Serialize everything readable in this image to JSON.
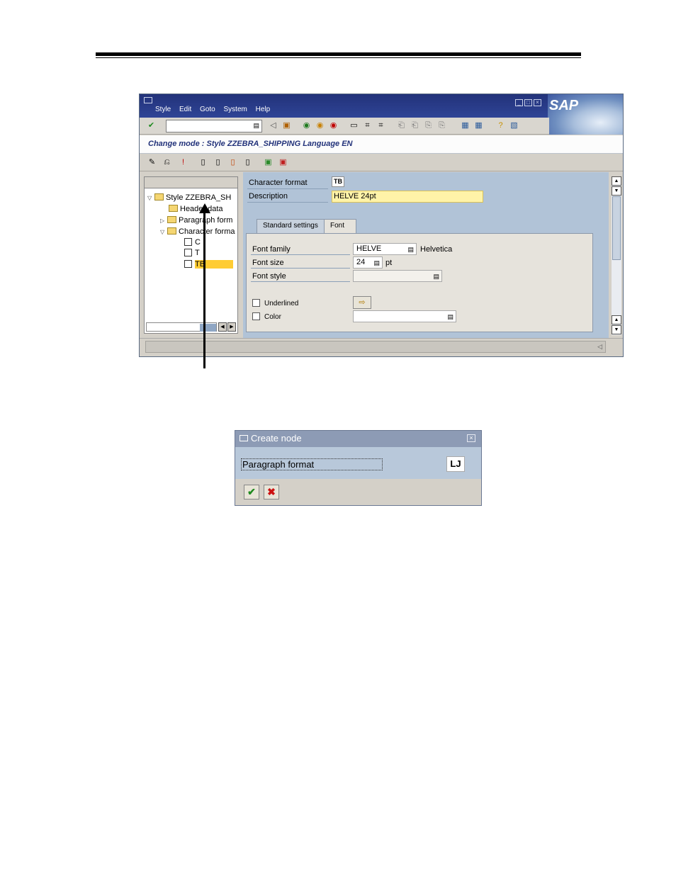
{
  "window": {
    "menu": [
      "Style",
      "Edit",
      "Goto",
      "System",
      "Help"
    ],
    "brand": "SAP",
    "mode_title": "Change mode : Style ZZEBRA_SHIPPING Language EN"
  },
  "tree": {
    "root": "Style ZZEBRA_SH",
    "header": "Header data",
    "paragraph": "Paragraph form",
    "character": "Character forma",
    "items": [
      "C",
      "T",
      "TB"
    ]
  },
  "detail": {
    "char_format_label": "Character format",
    "char_format_value": "TB",
    "description_label": "Description",
    "description_value": "HELVE 24pt",
    "tabs": [
      "Standard settings",
      "Font"
    ],
    "font_family_label": "Font family",
    "font_family_value": "HELVE",
    "font_family_desc": "Helvetica",
    "font_size_label": "Font size",
    "font_size_value": "24",
    "font_size_unit": "pt",
    "font_style_label": "Font style",
    "font_style_value": "",
    "underlined_label": "Underlined",
    "color_label": "Color",
    "color_value": ""
  },
  "dialog": {
    "title": "Create node",
    "field_value": "Paragraph format",
    "tag": "LJ"
  }
}
